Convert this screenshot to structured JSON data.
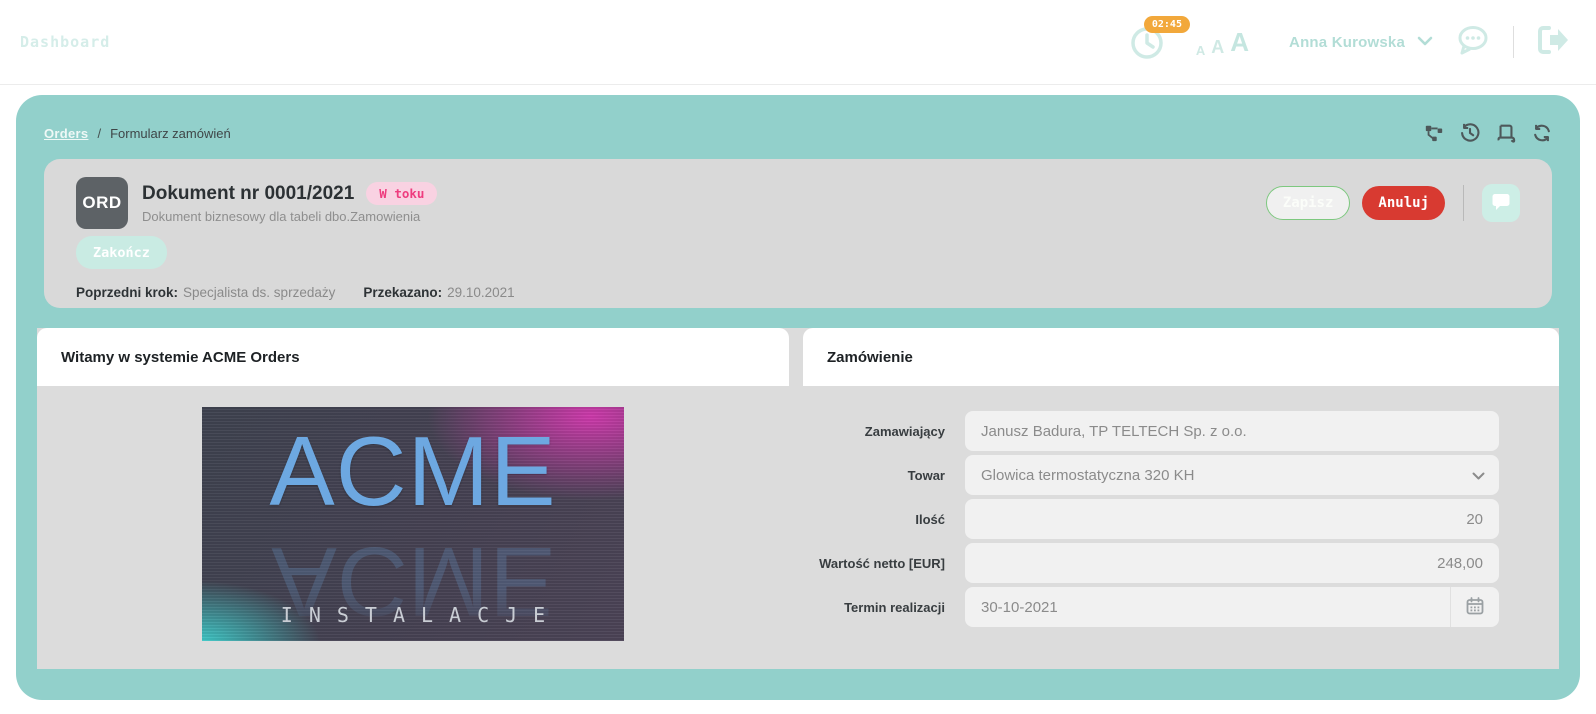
{
  "colors": {
    "accent_teal": "#92d0cb",
    "mint_light": "#cfeae5",
    "timer_orange": "#f2a83b",
    "status_pink_bg": "#f9d2e2",
    "status_pink_text": "#ee3d7f",
    "cancel_red": "#d83a31",
    "mint_button": "#c9ebe3",
    "card_gray": "#d9d9d9",
    "content_gray": "#dcdcdc",
    "badge_dark": "#5d6266"
  },
  "topbar": {
    "dashboard_label": "Dashboard",
    "timer_badge": "02:45",
    "font_small": "A",
    "font_medium": "A",
    "font_large": "A",
    "user_name": "Anna Kurowska"
  },
  "icons": [
    "clock-icon",
    "chat-icon",
    "logout-icon",
    "chevron-down-icon",
    "workflow-icon",
    "history-icon",
    "scroll-icon",
    "refresh-icon",
    "comment-icon",
    "calendar-icon",
    "select-chevron-icon"
  ],
  "breadcrumb": {
    "root": "Orders",
    "separator": "/",
    "current": "Formularz zamówień"
  },
  "document_header": {
    "type_badge": "ORD",
    "title": "Dokument nr 0001/2021",
    "status_badge": "W toku",
    "subtitle": "Dokument biznesowy dla tabeli dbo.Zamowienia",
    "save_label": "Zapisz",
    "cancel_label": "Anuluj",
    "finish_label": "Zakończ",
    "previous_step_label": "Poprzedni krok:",
    "previous_step_value": "Specjalista ds. sprzedaży",
    "handed_over_label": "Przekazano:",
    "handed_over_value": "29.10.2021"
  },
  "welcome_panel": {
    "title": "Witamy w systemie ACME Orders",
    "image_brand": "ACME",
    "image_subtitle": "INSTALACJE"
  },
  "order_panel": {
    "title": "Zamówienie",
    "fields": [
      {
        "label": "Zamawiający",
        "value": "Janusz Badura, TP TELTECH Sp. z o.o.",
        "type": "text"
      },
      {
        "label": "Towar",
        "value": "Glowica termostatyczna 320 KH",
        "type": "select"
      },
      {
        "label": "Ilość",
        "value": "20",
        "type": "number"
      },
      {
        "label": "Wartość netto [EUR]",
        "value": "248,00",
        "type": "number"
      },
      {
        "label": "Termin realizacji",
        "value": "30-10-2021",
        "type": "date"
      }
    ]
  }
}
